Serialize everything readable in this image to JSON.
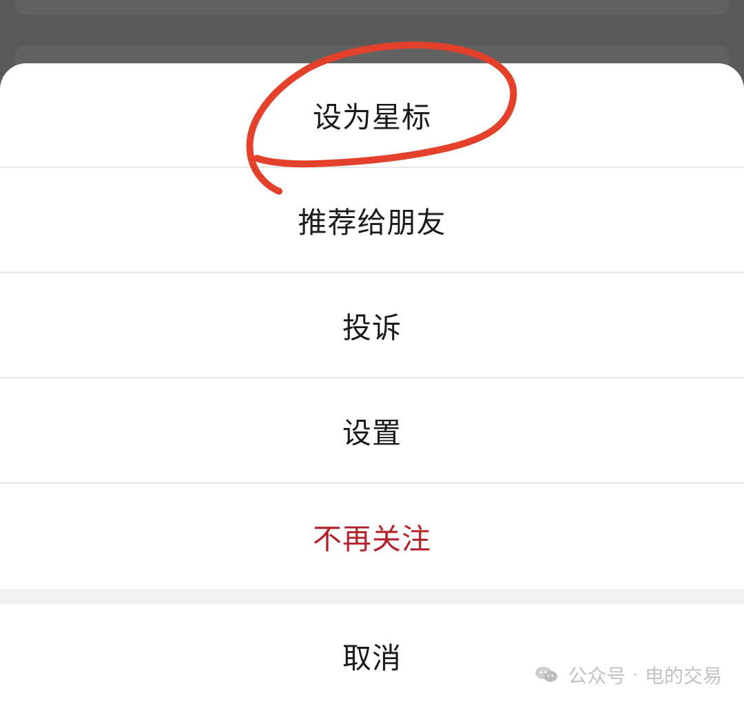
{
  "sheet": {
    "items": [
      {
        "label": "设为星标"
      },
      {
        "label": "推荐给朋友"
      },
      {
        "label": "投诉"
      },
      {
        "label": "设置"
      },
      {
        "label": "不再关注"
      }
    ],
    "cancel_label": "取消"
  },
  "watermark": {
    "account": "公众号",
    "separator": "·",
    "name": "电的交易",
    "icon": "wechat-icon"
  },
  "annotation": {
    "type": "hand-drawn-circle",
    "color": "#e3412b",
    "target": "设为星标"
  },
  "colors": {
    "danger": "#b4232b",
    "backdrop": "#5a5a5a",
    "sheet": "#ffffff",
    "divider": "#e6e6e6"
  }
}
